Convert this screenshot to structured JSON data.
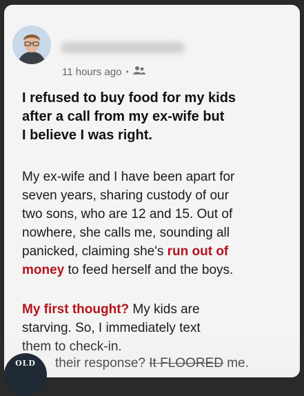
{
  "post": {
    "timestamp": "11 hours ago",
    "separator": "•",
    "title_lines": "I refused to buy food for my kids\nafter a call from my ex-wife but\nI believe I was right.",
    "para1_a": "My ex-wife and I have been apart for\nseven years, sharing custody of our\ntwo sons, who are 12 and 15. Out of\nnowhere, she calls me, sounding all\npanicked, claiming she's ",
    "para1_red": "run out of\nmoney",
    "para1_b": " to feed herself and the boys.",
    "para2_red": "My first thought?",
    "para2_b": " My kids are\nstarving. So, I immediately text\nthem to check-in.",
    "para3_a": "their response? ",
    "para3_strike": "It FLOORED",
    "para3_b": " me."
  },
  "watermark": {
    "text": "OLD"
  },
  "icons": {
    "audience": "friends-icon",
    "avatar": "avatar"
  }
}
